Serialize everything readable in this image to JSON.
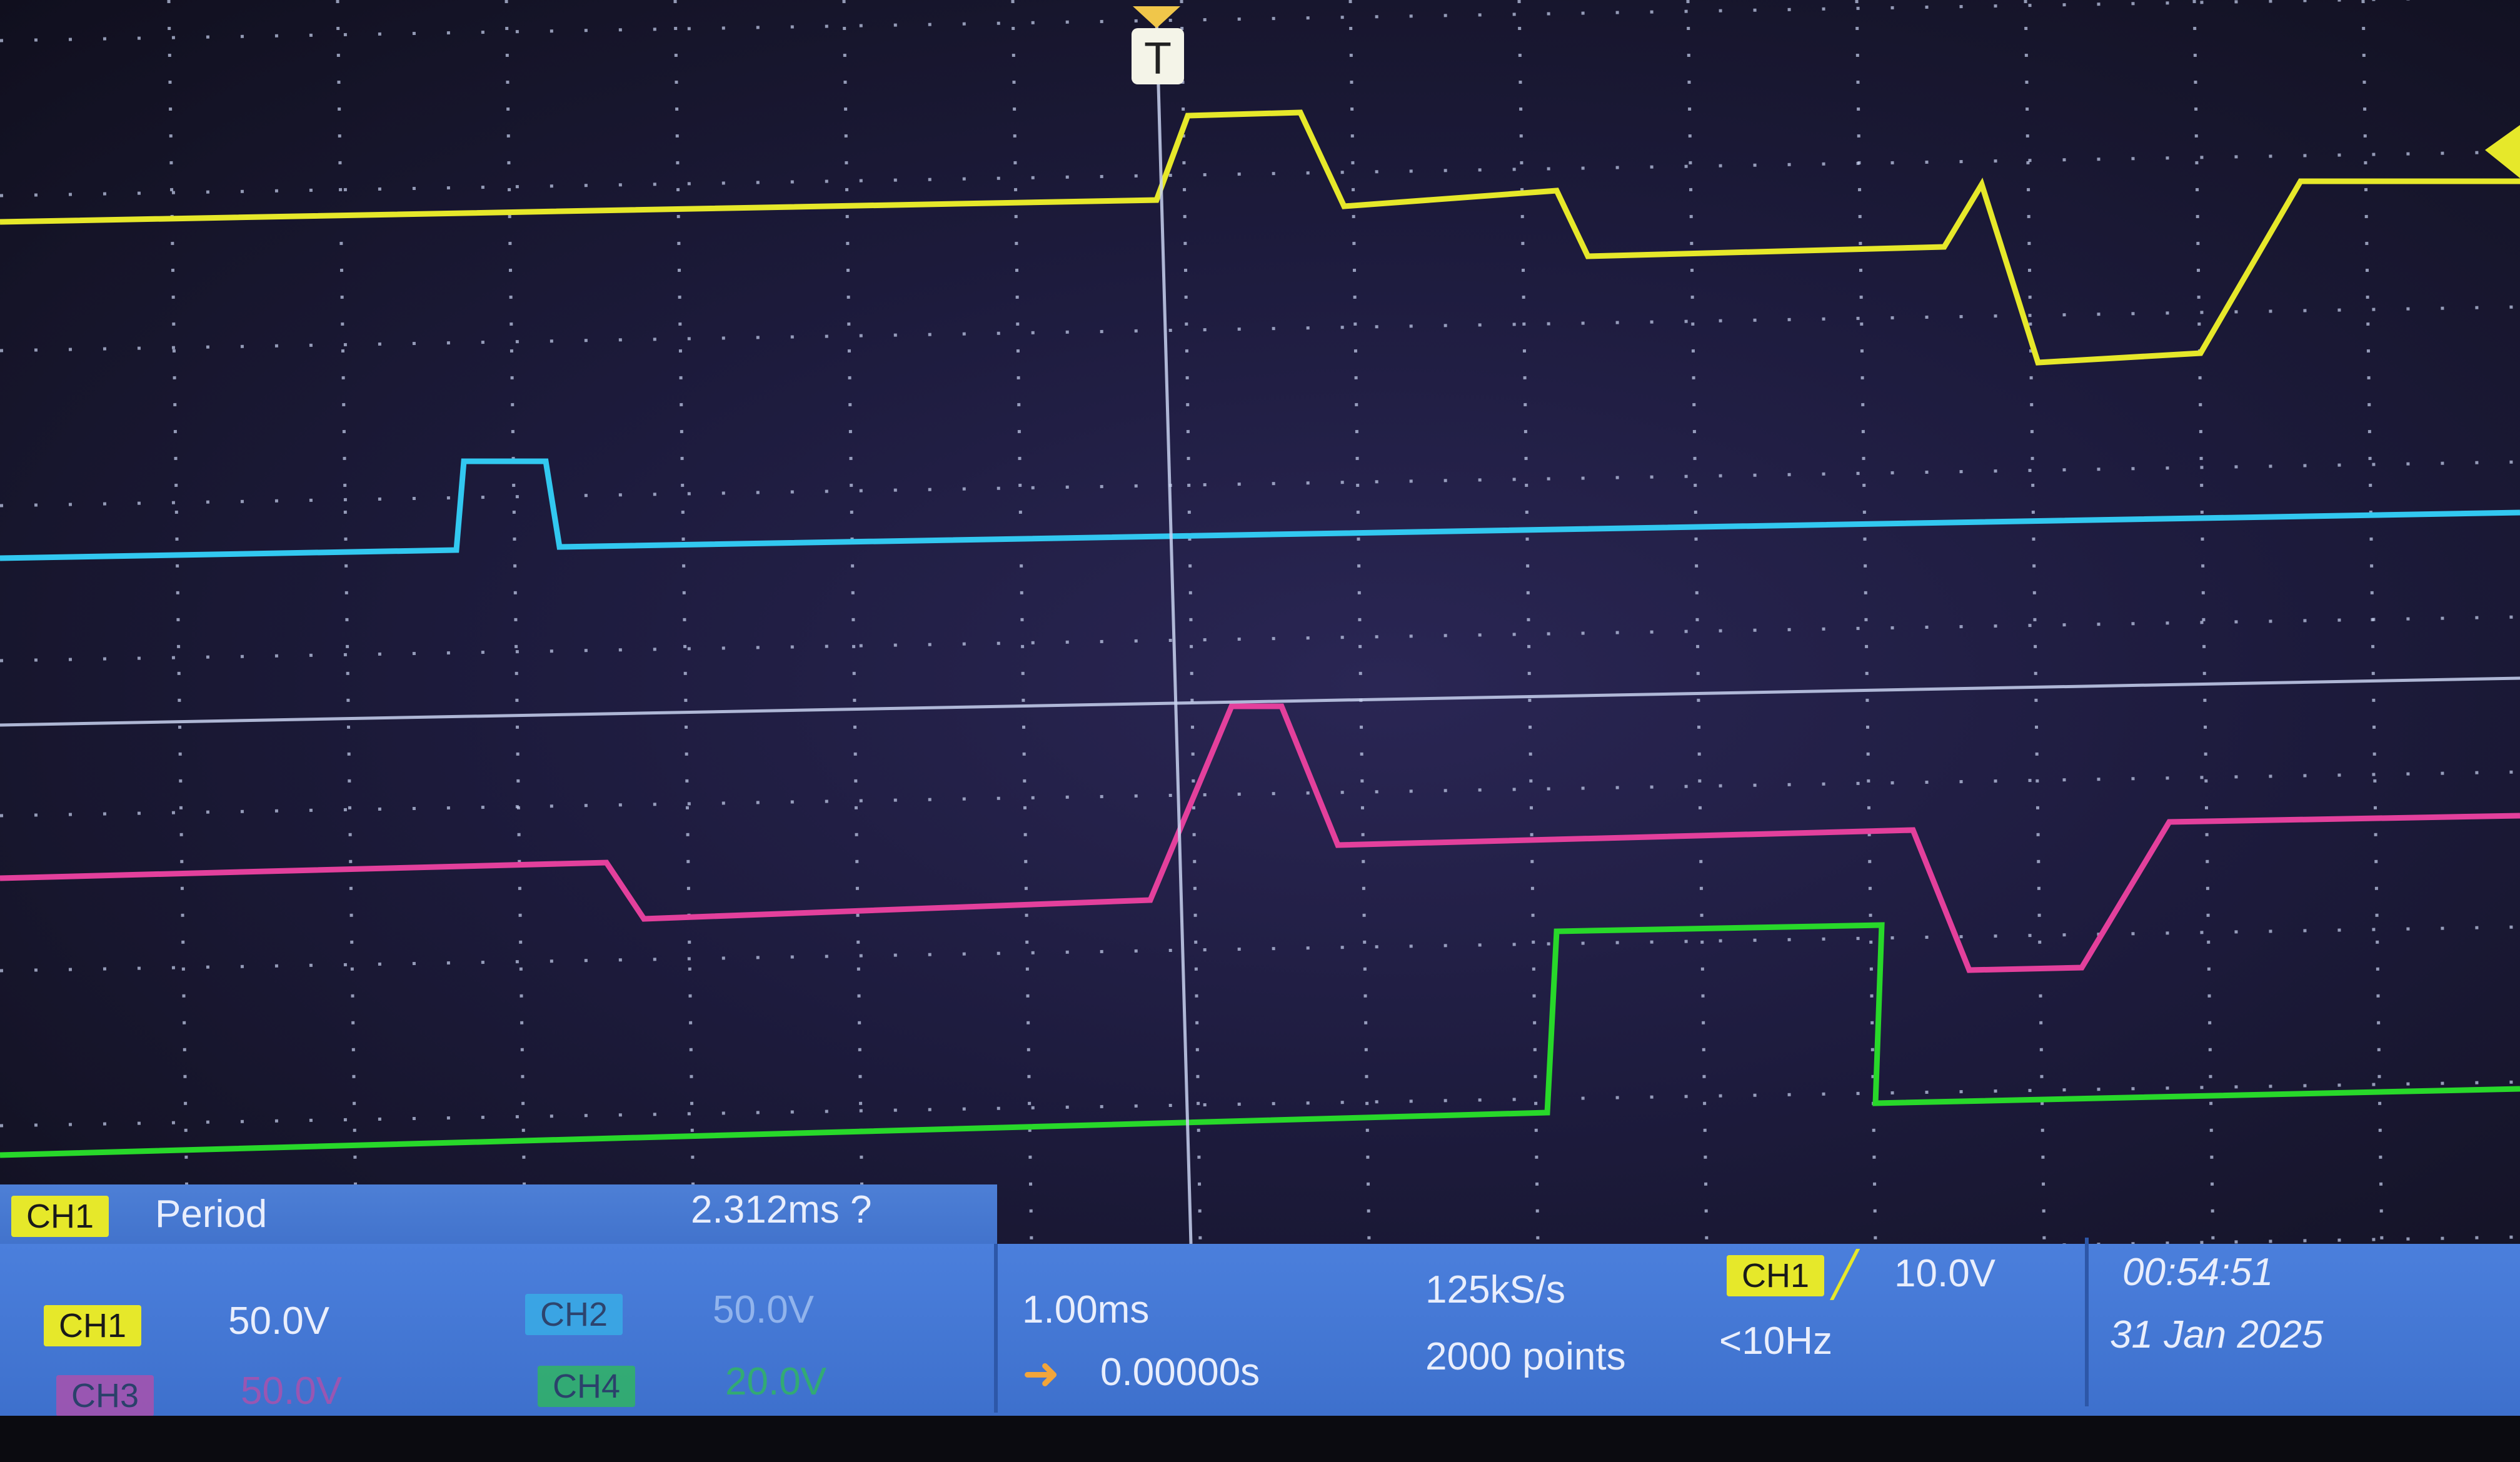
{
  "measurement": {
    "channel": "CH1",
    "label": "Period",
    "value": "2.312ms ?"
  },
  "channels": [
    {
      "id": "ch1",
      "name": "CH1",
      "scale": "50.0V",
      "color": "#e6e82a"
    },
    {
      "id": "ch2",
      "name": "CH2",
      "scale": "50.0V",
      "color": "#32c8f0"
    },
    {
      "id": "ch3",
      "name": "CH3",
      "scale": "50.0V",
      "color": "#e3409c"
    },
    {
      "id": "ch4",
      "name": "CH4",
      "scale": "20.0V",
      "color": "#28d82a"
    }
  ],
  "horizontal": {
    "timebase": "1.00ms",
    "position": "0.00000s",
    "sample_rate": "125kS/s",
    "record_length": "2000 points"
  },
  "trigger": {
    "source": "CH1",
    "level": "10.0V",
    "frequency": "<10Hz",
    "marker": "T"
  },
  "clock": {
    "time": "00:54:51",
    "date": "31 Jan 2025"
  },
  "colors": {
    "grid": "#c8d2f0",
    "screen_bg": "#1d1b3d",
    "panel_bg": "#4272cc"
  }
}
